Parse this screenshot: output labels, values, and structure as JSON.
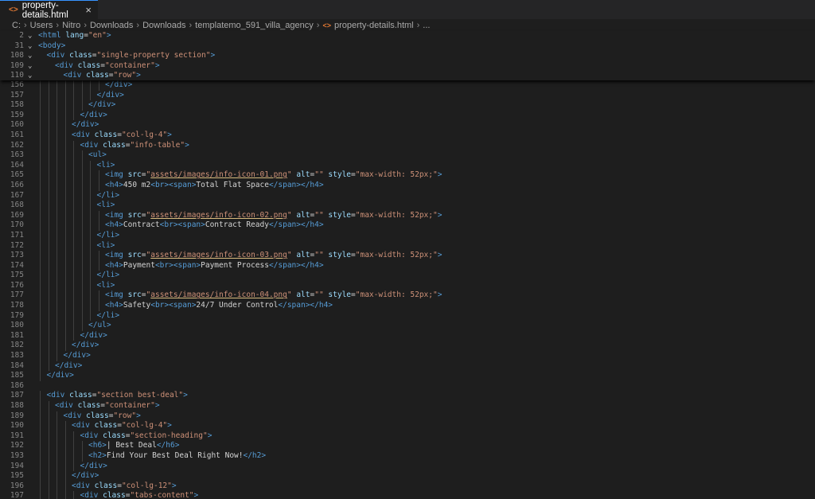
{
  "tab": {
    "filename": "property-details.html",
    "icon": "html-file-icon",
    "close": "×"
  },
  "breadcrumb": {
    "segments": [
      "C:",
      "Users",
      "Nitro",
      "Downloads",
      "Downloads",
      "templatemo_591_villa_agency",
      "property-details.html",
      "..."
    ]
  },
  "sticky_lines": [
    {
      "n": "2",
      "indent": 0,
      "fold": true,
      "tokens": [
        [
          "tg",
          "<html "
        ],
        [
          "at",
          "lang"
        ],
        [
          "tx",
          "="
        ],
        [
          "st",
          "\"en\""
        ],
        [
          "tg",
          ">"
        ]
      ]
    },
    {
      "n": "31",
      "indent": 0,
      "fold": true,
      "tokens": [
        [
          "tg",
          "<body>"
        ]
      ]
    },
    {
      "n": "108",
      "indent": 1,
      "fold": true,
      "tokens": [
        [
          "tg",
          "<div "
        ],
        [
          "at",
          "class"
        ],
        [
          "tx",
          "="
        ],
        [
          "st",
          "\"single-property section\""
        ],
        [
          "tg",
          ">"
        ]
      ]
    },
    {
      "n": "109",
      "indent": 2,
      "fold": true,
      "tokens": [
        [
          "tg",
          "<div "
        ],
        [
          "at",
          "class"
        ],
        [
          "tx",
          "="
        ],
        [
          "st",
          "\"container\""
        ],
        [
          "tg",
          ">"
        ]
      ]
    },
    {
      "n": "110",
      "indent": 3,
      "fold": true,
      "tokens": [
        [
          "tg",
          "<div "
        ],
        [
          "at",
          "class"
        ],
        [
          "tx",
          "="
        ],
        [
          "st",
          "\"row\""
        ],
        [
          "tg",
          ">"
        ]
      ]
    }
  ],
  "lines": [
    {
      "n": "156",
      "indent": 8,
      "tokens": [
        [
          "tg",
          "</div>"
        ]
      ]
    },
    {
      "n": "157",
      "indent": 7,
      "tokens": [
        [
          "tg",
          "</div>"
        ]
      ]
    },
    {
      "n": "158",
      "indent": 6,
      "tokens": [
        [
          "tg",
          "</div>"
        ]
      ]
    },
    {
      "n": "159",
      "indent": 5,
      "tokens": [
        [
          "tg",
          "</div>"
        ]
      ]
    },
    {
      "n": "160",
      "indent": 4,
      "tokens": [
        [
          "tg",
          "</div>"
        ]
      ]
    },
    {
      "n": "161",
      "indent": 4,
      "tokens": [
        [
          "tg",
          "<div "
        ],
        [
          "at",
          "class"
        ],
        [
          "tx",
          "="
        ],
        [
          "st",
          "\"col-lg-4\""
        ],
        [
          "tg",
          ">"
        ]
      ]
    },
    {
      "n": "162",
      "indent": 5,
      "tokens": [
        [
          "tg",
          "<div "
        ],
        [
          "at",
          "class"
        ],
        [
          "tx",
          "="
        ],
        [
          "st",
          "\"info-table\""
        ],
        [
          "tg",
          ">"
        ]
      ]
    },
    {
      "n": "163",
      "indent": 6,
      "tokens": [
        [
          "tg",
          "<ul>"
        ]
      ]
    },
    {
      "n": "164",
      "indent": 7,
      "tokens": [
        [
          "tg",
          "<li>"
        ]
      ]
    },
    {
      "n": "165",
      "indent": 8,
      "tokens": [
        [
          "tg",
          "<img "
        ],
        [
          "at",
          "src"
        ],
        [
          "tx",
          "="
        ],
        [
          "st",
          "\""
        ],
        [
          "sl",
          "assets/images/info-icon-01.png"
        ],
        [
          "st",
          "\""
        ],
        [
          "tx",
          " "
        ],
        [
          "at",
          "alt"
        ],
        [
          "tx",
          "="
        ],
        [
          "st",
          "\"\""
        ],
        [
          "tx",
          " "
        ],
        [
          "at",
          "style"
        ],
        [
          "tx",
          "="
        ],
        [
          "st",
          "\"max-width: 52px;\""
        ],
        [
          "tg",
          ">"
        ]
      ]
    },
    {
      "n": "166",
      "indent": 8,
      "tokens": [
        [
          "tg",
          "<h4>"
        ],
        [
          "tx",
          "450 m2"
        ],
        [
          "tg",
          "<br><span>"
        ],
        [
          "tx",
          "Total Flat Space"
        ],
        [
          "tg",
          "</span></h4>"
        ]
      ]
    },
    {
      "n": "167",
      "indent": 7,
      "tokens": [
        [
          "tg",
          "</li>"
        ]
      ]
    },
    {
      "n": "168",
      "indent": 7,
      "tokens": [
        [
          "tg",
          "<li>"
        ]
      ]
    },
    {
      "n": "169",
      "indent": 8,
      "tokens": [
        [
          "tg",
          "<img "
        ],
        [
          "at",
          "src"
        ],
        [
          "tx",
          "="
        ],
        [
          "st",
          "\""
        ],
        [
          "sl",
          "assets/images/info-icon-02.png"
        ],
        [
          "st",
          "\""
        ],
        [
          "tx",
          " "
        ],
        [
          "at",
          "alt"
        ],
        [
          "tx",
          "="
        ],
        [
          "st",
          "\"\""
        ],
        [
          "tx",
          " "
        ],
        [
          "at",
          "style"
        ],
        [
          "tx",
          "="
        ],
        [
          "st",
          "\"max-width: 52px;\""
        ],
        [
          "tg",
          ">"
        ]
      ]
    },
    {
      "n": "170",
      "indent": 8,
      "tokens": [
        [
          "tg",
          "<h4>"
        ],
        [
          "tx",
          "Contract"
        ],
        [
          "tg",
          "<br><span>"
        ],
        [
          "tx",
          "Contract Ready"
        ],
        [
          "tg",
          "</span></h4>"
        ]
      ]
    },
    {
      "n": "171",
      "indent": 7,
      "tokens": [
        [
          "tg",
          "</li>"
        ]
      ]
    },
    {
      "n": "172",
      "indent": 7,
      "tokens": [
        [
          "tg",
          "<li>"
        ]
      ]
    },
    {
      "n": "173",
      "indent": 8,
      "tokens": [
        [
          "tg",
          "<img "
        ],
        [
          "at",
          "src"
        ],
        [
          "tx",
          "="
        ],
        [
          "st",
          "\""
        ],
        [
          "sl",
          "assets/images/info-icon-03.png"
        ],
        [
          "st",
          "\""
        ],
        [
          "tx",
          " "
        ],
        [
          "at",
          "alt"
        ],
        [
          "tx",
          "="
        ],
        [
          "st",
          "\"\""
        ],
        [
          "tx",
          " "
        ],
        [
          "at",
          "style"
        ],
        [
          "tx",
          "="
        ],
        [
          "st",
          "\"max-width: 52px;\""
        ],
        [
          "tg",
          ">"
        ]
      ]
    },
    {
      "n": "174",
      "indent": 8,
      "tokens": [
        [
          "tg",
          "<h4>"
        ],
        [
          "tx",
          "Payment"
        ],
        [
          "tg",
          "<br><span>"
        ],
        [
          "tx",
          "Payment Process"
        ],
        [
          "tg",
          "</span></h4>"
        ]
      ]
    },
    {
      "n": "175",
      "indent": 7,
      "tokens": [
        [
          "tg",
          "</li>"
        ]
      ]
    },
    {
      "n": "176",
      "indent": 7,
      "tokens": [
        [
          "tg",
          "<li>"
        ]
      ]
    },
    {
      "n": "177",
      "indent": 8,
      "tokens": [
        [
          "tg",
          "<img "
        ],
        [
          "at",
          "src"
        ],
        [
          "tx",
          "="
        ],
        [
          "st",
          "\""
        ],
        [
          "sl",
          "assets/images/info-icon-04.png"
        ],
        [
          "st",
          "\""
        ],
        [
          "tx",
          " "
        ],
        [
          "at",
          "alt"
        ],
        [
          "tx",
          "="
        ],
        [
          "st",
          "\"\""
        ],
        [
          "tx",
          " "
        ],
        [
          "at",
          "style"
        ],
        [
          "tx",
          "="
        ],
        [
          "st",
          "\"max-width: 52px;\""
        ],
        [
          "tg",
          ">"
        ]
      ]
    },
    {
      "n": "178",
      "indent": 8,
      "tokens": [
        [
          "tg",
          "<h4>"
        ],
        [
          "tx",
          "Safety"
        ],
        [
          "tg",
          "<br><span>"
        ],
        [
          "tx",
          "24/7 Under Control"
        ],
        [
          "tg",
          "</span></h4>"
        ]
      ]
    },
    {
      "n": "179",
      "indent": 7,
      "tokens": [
        [
          "tg",
          "</li>"
        ]
      ]
    },
    {
      "n": "180",
      "indent": 6,
      "tokens": [
        [
          "tg",
          "</ul>"
        ]
      ]
    },
    {
      "n": "181",
      "indent": 5,
      "tokens": [
        [
          "tg",
          "</div>"
        ]
      ]
    },
    {
      "n": "182",
      "indent": 4,
      "tokens": [
        [
          "tg",
          "</div>"
        ]
      ]
    },
    {
      "n": "183",
      "indent": 3,
      "tokens": [
        [
          "tg",
          "</div>"
        ]
      ]
    },
    {
      "n": "184",
      "indent": 2,
      "tokens": [
        [
          "tg",
          "</div>"
        ]
      ]
    },
    {
      "n": "185",
      "indent": 1,
      "tokens": [
        [
          "tg",
          "</div>"
        ]
      ]
    },
    {
      "n": "186",
      "indent": 0,
      "tokens": []
    },
    {
      "n": "187",
      "indent": 1,
      "tokens": [
        [
          "tg",
          "<div "
        ],
        [
          "at",
          "class"
        ],
        [
          "tx",
          "="
        ],
        [
          "st",
          "\"section best-deal\""
        ],
        [
          "tg",
          ">"
        ]
      ]
    },
    {
      "n": "188",
      "indent": 2,
      "tokens": [
        [
          "tg",
          "<div "
        ],
        [
          "at",
          "class"
        ],
        [
          "tx",
          "="
        ],
        [
          "st",
          "\"container\""
        ],
        [
          "tg",
          ">"
        ]
      ]
    },
    {
      "n": "189",
      "indent": 3,
      "tokens": [
        [
          "tg",
          "<div "
        ],
        [
          "at",
          "class"
        ],
        [
          "tx",
          "="
        ],
        [
          "st",
          "\"row\""
        ],
        [
          "tg",
          ">"
        ]
      ]
    },
    {
      "n": "190",
      "indent": 4,
      "tokens": [
        [
          "tg",
          "<div "
        ],
        [
          "at",
          "class"
        ],
        [
          "tx",
          "="
        ],
        [
          "st",
          "\"col-lg-4\""
        ],
        [
          "tg",
          ">"
        ]
      ]
    },
    {
      "n": "191",
      "indent": 5,
      "tokens": [
        [
          "tg",
          "<div "
        ],
        [
          "at",
          "class"
        ],
        [
          "tx",
          "="
        ],
        [
          "st",
          "\"section-heading\""
        ],
        [
          "tg",
          ">"
        ]
      ]
    },
    {
      "n": "192",
      "indent": 6,
      "tokens": [
        [
          "tg",
          "<h6>"
        ],
        [
          "tx",
          "| Best Deal"
        ],
        [
          "tg",
          "</h6>"
        ]
      ]
    },
    {
      "n": "193",
      "indent": 6,
      "tokens": [
        [
          "tg",
          "<h2>"
        ],
        [
          "tx",
          "Find Your Best Deal Right Now!"
        ],
        [
          "tg",
          "</h2>"
        ]
      ]
    },
    {
      "n": "194",
      "indent": 5,
      "tokens": [
        [
          "tg",
          "</div>"
        ]
      ]
    },
    {
      "n": "195",
      "indent": 4,
      "tokens": [
        [
          "tg",
          "</div>"
        ]
      ]
    },
    {
      "n": "196",
      "indent": 4,
      "tokens": [
        [
          "tg",
          "<div "
        ],
        [
          "at",
          "class"
        ],
        [
          "tx",
          "="
        ],
        [
          "st",
          "\"col-lg-12\""
        ],
        [
          "tg",
          ">"
        ]
      ]
    },
    {
      "n": "197",
      "indent": 5,
      "tokens": [
        [
          "tg",
          "<div "
        ],
        [
          "at",
          "class"
        ],
        [
          "tx",
          "="
        ],
        [
          "st",
          "\"tabs-content\""
        ],
        [
          "tg",
          ">"
        ]
      ]
    }
  ]
}
